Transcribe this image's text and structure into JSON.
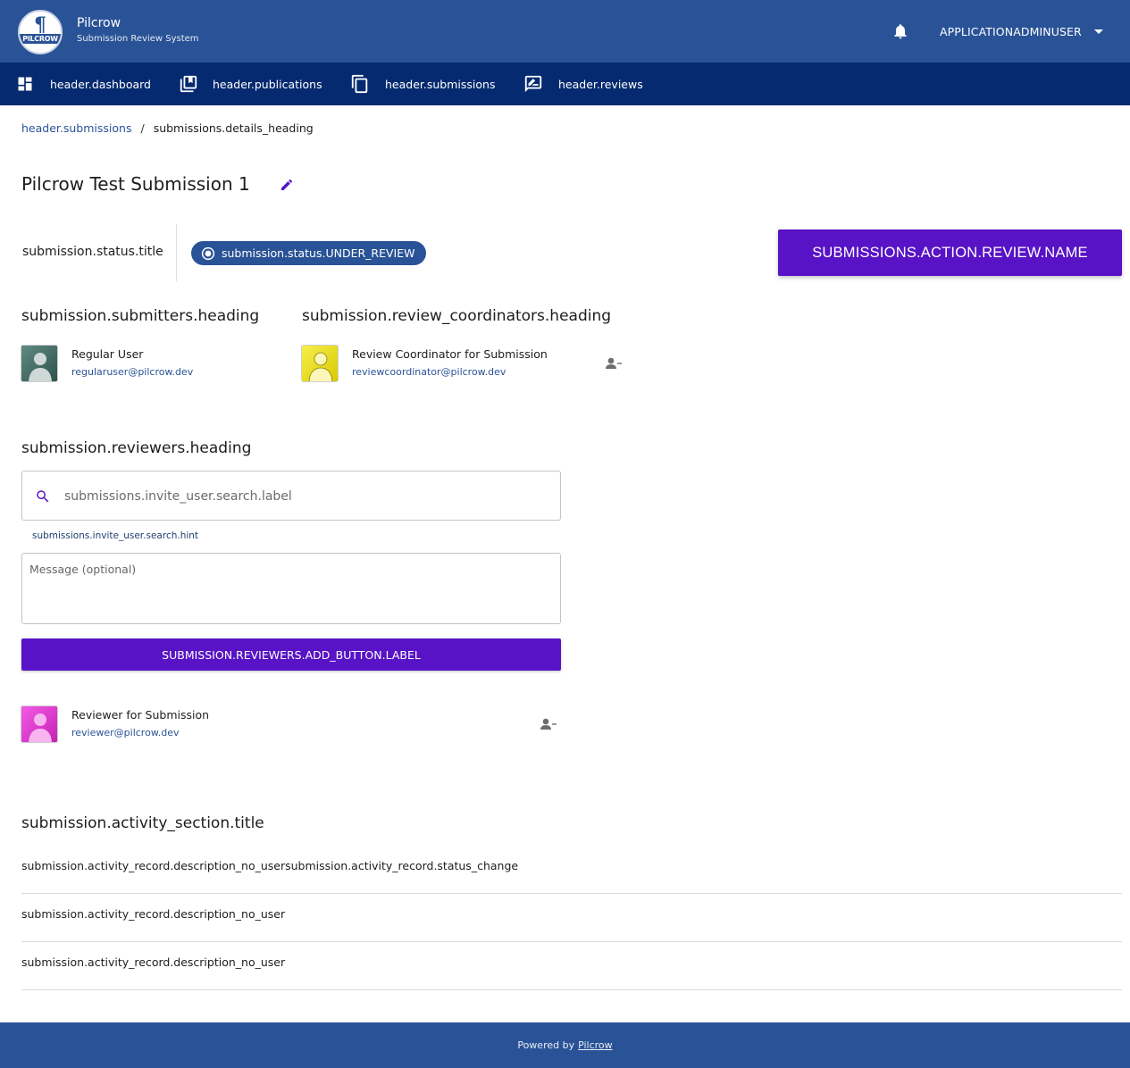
{
  "header": {
    "app_title": "Pilcrow",
    "app_subtitle": "Submission Review System",
    "logo_band_text": "PILCROW",
    "logo_symbol": "¶",
    "user_name": "APPLICATIONADMINUSER",
    "icons": [
      "bell-icon",
      "chevron-down-icon"
    ]
  },
  "nav": {
    "items": [
      {
        "label": "header.dashboard",
        "icon": "dashboard-icon"
      },
      {
        "label": "header.publications",
        "icon": "publications-icon"
      },
      {
        "label": "header.submissions",
        "icon": "copy-icon"
      },
      {
        "label": "header.reviews",
        "icon": "rate-review-icon"
      }
    ]
  },
  "breadcrumb": {
    "link": "header.submissions",
    "separator": "/",
    "current": "submissions.details_heading"
  },
  "page": {
    "title": "Pilcrow Test Submission 1"
  },
  "status": {
    "label": "submission.status.title",
    "value": "submission.status.UNDER_REVIEW",
    "action_button": "SUBMISSIONS.ACTION.REVIEW.NAME"
  },
  "submitters": {
    "heading": "submission.submitters.heading",
    "users": [
      {
        "name": "Regular User",
        "email": "regularuser@pilcrow.dev",
        "avatar_color": "#3f6b62"
      }
    ]
  },
  "review_coordinators": {
    "heading": "submission.review_coordinators.heading",
    "users": [
      {
        "name": "Review Coordinator for Submission",
        "email": "reviewcoordinator@pilcrow.dev",
        "avatar_color": "#f2e600"
      }
    ]
  },
  "reviewers": {
    "heading": "submission.reviewers.heading",
    "search_placeholder": "submissions.invite_user.search.label",
    "search_hint": "submissions.invite_user.search.hint",
    "message_placeholder": "Message (optional)",
    "add_button": "SUBMISSION.REVIEWERS.ADD_BUTTON.LABEL",
    "users": [
      {
        "name": "Reviewer for Submission",
        "email": "reviewer@pilcrow.dev",
        "avatar_color": "#e83ad6"
      }
    ]
  },
  "activity": {
    "title": "submission.activity_section.title",
    "records": [
      "submission.activity_record.description_no_usersubmission.activity_record.status_change",
      "submission.activity_record.description_no_user",
      "submission.activity_record.description_no_user"
    ]
  },
  "footer": {
    "prefix": "Powered by",
    "link": "Pilcrow"
  },
  "colors": {
    "header_bg": "#2a5397",
    "nav_bg": "#052a70",
    "accent_purple": "#5713c5",
    "link_blue": "#2a5397"
  }
}
